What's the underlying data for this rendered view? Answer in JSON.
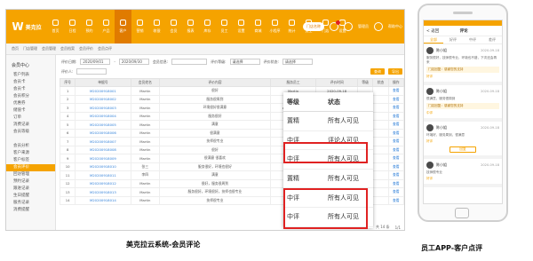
{
  "app": {
    "logo_text": "美克拉",
    "nav_items": [
      "首页",
      "日程",
      "预约",
      "产品",
      "客户",
      "营销",
      "收银",
      "会员",
      "报表",
      "库存",
      "员工",
      "设置",
      "商城",
      "小程序",
      "统计",
      "员工",
      "门店",
      "设置"
    ],
    "active_nav": 4,
    "top_right": {
      "store_pill": "门店名称",
      "user_label": "管理员",
      "help_label": "帮助中心"
    }
  },
  "breadcrumb": [
    "首页",
    "门店管理",
    "会员管理",
    "会员档案",
    "会员评价",
    "会员点评"
  ],
  "sidebar": {
    "heading": "会员中心",
    "items": [
      "客户列表",
      "会员卡",
      "会员卡",
      "会员积分",
      "优惠券",
      "储值卡",
      "订单",
      "消费记录",
      "会员等级",
      "",
      "会员分析",
      "客户来源",
      "客户标签",
      "会员评价",
      "回访管理",
      "预约记录",
      "跟进记录",
      "生日提醒",
      "服务记录",
      "消费提醒"
    ],
    "active_index": 13
  },
  "filters": {
    "date_label": "评价日期:",
    "date_from": "2020/09/01",
    "date_to": "2020/09/30",
    "member_label": "会员信息:",
    "level_label": "评价等级:",
    "level_value": "请选择",
    "status_label": "评价状态:",
    "status_value": "请选择",
    "emp_label": "评价人:",
    "query_btn": "查询",
    "export_btn": "导出"
  },
  "table": {
    "headers": [
      "序号",
      "单据号",
      "会员姓名",
      "评价内容",
      "服务员工",
      "评价时间",
      "等级",
      "状态",
      "操作"
    ],
    "rows": [
      [
        "1",
        "M20200918001",
        "Martin",
        "很好",
        "Martin",
        "2020-09-18",
        "",
        "",
        ""
      ],
      [
        "2",
        "M20200918002",
        "Martin",
        "服务很周到",
        "Martin",
        "2020-09-18",
        "",
        "",
        ""
      ],
      [
        "3",
        "M20200918003",
        "Martin",
        "环境很好很满意",
        "anne, steven",
        "2020-09-18",
        "",
        "",
        ""
      ],
      [
        "4",
        "M20200918004",
        "Martin",
        "服务很好",
        "steven",
        "2020-09-18",
        "",
        "",
        ""
      ],
      [
        "5",
        "M20200918005",
        "Martin",
        "满意",
        "steven",
        "2020-09-18",
        "",
        "",
        ""
      ],
      [
        "6",
        "M20200918006",
        "Martin",
        "很满意",
        "Martin",
        "2020-09-18",
        "",
        "",
        ""
      ],
      [
        "7",
        "M20200918007",
        "Martin",
        "技师很专业",
        "Martin",
        "2020-09-18",
        "",
        "",
        ""
      ],
      [
        "8",
        "M20200918008",
        "Martin",
        "很好",
        "Emily",
        "2020-09-18",
        "",
        "",
        ""
      ],
      [
        "9",
        "M20200918009",
        "Martin",
        "很满意 很喜欢",
        "Emily",
        "2020-09-18",
        "",
        "",
        ""
      ],
      [
        "10",
        "M20200918010",
        "张三",
        "服务很好，环境也很好",
        "Emily",
        "2020-09-18",
        "",
        "",
        ""
      ],
      [
        "11",
        "M20200918011",
        "李四",
        "满意",
        "Emily",
        "2020-09-18",
        "",
        "",
        ""
      ],
      [
        "12",
        "M20200918012",
        "Martin",
        "很好，服务很周到",
        "Martin",
        "2020-09-18",
        "",
        "",
        ""
      ],
      [
        "13",
        "M20200918013",
        "Martin",
        "服务很好，环境很好，技师也很专业",
        "Martin",
        "2020-09-18",
        "",
        "",
        ""
      ],
      [
        "14",
        "M20200918014",
        "Martin",
        "技师很专业",
        "Martin",
        "2020-09-18",
        "",
        "",
        ""
      ]
    ],
    "action_label": "查看"
  },
  "pager": {
    "summary": "共 14 条",
    "page": "1/1"
  },
  "zoom": {
    "headers": [
      "等级",
      "状态"
    ],
    "rows": [
      [
        "置精",
        "所有人可见"
      ],
      [
        "中评",
        "评论人可见"
      ],
      [
        "中评",
        "所有人可见"
      ],
      [
        "置精",
        "所有人可见"
      ],
      [
        "中评",
        "所有人可见"
      ],
      [
        "中评",
        "所有人可见"
      ]
    ]
  },
  "captions": {
    "left": "美克拉云系统-会员评论",
    "right": "员工APP-客户点评"
  },
  "phone": {
    "title": "评论",
    "back": "< 返回",
    "tabs": [
      "全部",
      "好评",
      "中评",
      "差评"
    ],
    "reviews": [
      {
        "name": "陈小姐",
        "time": "2020-09-18",
        "text": "服务很好，技师很专业，环境也不错，下次还会再来",
        "reply": "门店回复：感谢您的支持",
        "tag": "好评"
      },
      {
        "name": "陈小姐",
        "time": "2020-09-18",
        "text": "很满意，服务很周到",
        "reply": "门店回复：感谢您的支持",
        "tag": "中评"
      },
      {
        "name": "陈小姐",
        "time": "2020-09-18",
        "text": "环境好，服务周到，很满意",
        "reply": "",
        "tag": "好评"
      },
      {
        "name": "陈小姐",
        "time": "2020-09-18",
        "text": "技师很专业",
        "reply": "",
        "tag": "好评"
      }
    ],
    "reply_btn": "回复"
  },
  "colors": {
    "brand": "#f5a300",
    "highlight": "#e02222",
    "link": "#2f7fd8"
  }
}
